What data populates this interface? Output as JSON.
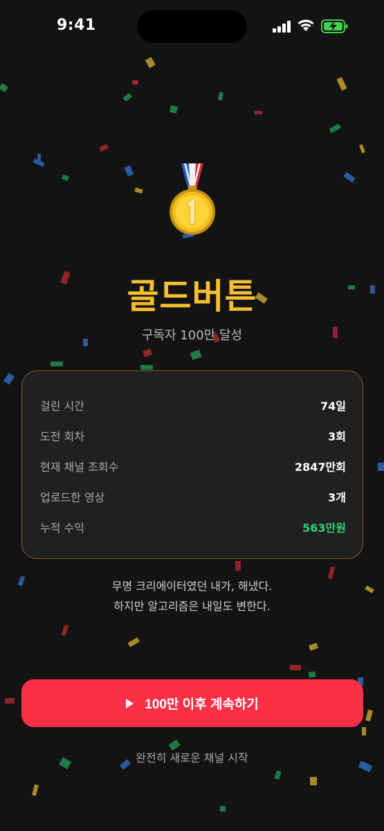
{
  "status_bar": {
    "time": "9:41"
  },
  "achievement": {
    "icon": "gold-medal-icon",
    "medal_number": "1",
    "title": "골드버튼",
    "subtitle": "구독자 100만 달성"
  },
  "stats": [
    {
      "label": "걸린 시간",
      "value": "74일",
      "highlight": false
    },
    {
      "label": "도전 회차",
      "value": "3회",
      "highlight": false
    },
    {
      "label": "현재 채널 조회수",
      "value": "2847만회",
      "highlight": false
    },
    {
      "label": "업로드한 영상",
      "value": "3개",
      "highlight": false
    },
    {
      "label": "누적 수익",
      "value": "563만원",
      "highlight": true
    }
  ],
  "message": {
    "line1": "무명 크리에이터였던 내가, 해냈다.",
    "line2": "하지만 알고리즘은 내일도 변한다."
  },
  "actions": {
    "continue_label": "100만 이후 계속하기",
    "new_channel_label": "완전히 새로운 채널 시작"
  },
  "colors": {
    "background": "#131313",
    "gold": "#f6bf2f",
    "accent_red": "#fa3046",
    "revenue_green": "#31d178",
    "card_border": "#7a6424"
  }
}
